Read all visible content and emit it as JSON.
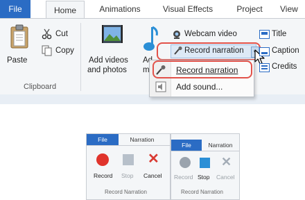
{
  "tabs": [
    "File",
    "Home",
    "Animations",
    "Visual Effects",
    "Project",
    "View"
  ],
  "clipboard": {
    "paste": "Paste",
    "cut": "Cut",
    "copy": "Copy",
    "group_label": "Clipboard"
  },
  "add_videos": {
    "line1": "Add videos",
    "line2": "and photos"
  },
  "add_music_partial": {
    "line1": "Ad",
    "line2": "mu"
  },
  "record_items": {
    "webcam": "Webcam video",
    "record_narration": "Record narration"
  },
  "text_items": {
    "title": "Title",
    "caption": "Caption",
    "credits": "Credits"
  },
  "dropdown": {
    "items": [
      "Record narration",
      "Add sound..."
    ]
  },
  "narration_left": {
    "tabs": [
      "File",
      "Narration"
    ],
    "buttons": [
      "Record",
      "Stop",
      "Cancel"
    ],
    "group_label": "Record Narration"
  },
  "narration_right": {
    "tabs": [
      "File",
      "Narration"
    ],
    "buttons": [
      "Record",
      "Stop",
      "Cancel"
    ],
    "group_label": "Record Narration"
  },
  "colors": {
    "accent": "#2b6cc4",
    "highlight": "#e2524a",
    "record": "#e0342c",
    "stop": "#2b8fd6"
  }
}
